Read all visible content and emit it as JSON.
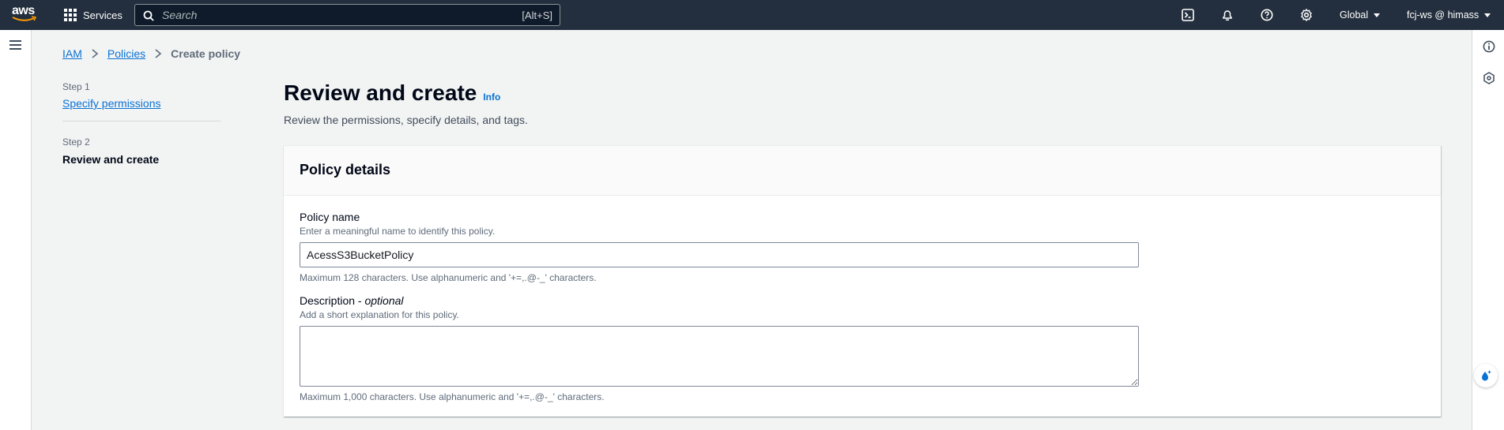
{
  "topnav": {
    "logo_text": "aws",
    "services_label": "Services",
    "search_placeholder": "Search",
    "search_shortcut": "[Alt+S]",
    "region": "Global",
    "account": "fcj-ws @ himass"
  },
  "breadcrumb": {
    "items": [
      "IAM",
      "Policies"
    ],
    "current": "Create policy"
  },
  "steps": [
    {
      "label": "Step 1",
      "title": "Specify permissions"
    },
    {
      "label": "Step 2",
      "title": "Review and create"
    }
  ],
  "header": {
    "title": "Review and create",
    "info": "Info",
    "description": "Review the permissions, specify details, and tags."
  },
  "policy_details": {
    "title": "Policy details",
    "name_label": "Policy name",
    "name_desc": "Enter a meaningful name to identify this policy.",
    "name_value": "AcessS3BucketPolicy",
    "name_constraint": "Maximum 128 characters. Use alphanumeric and '+=,.@-_' characters.",
    "description_label": "Description - ",
    "description_optional": "optional",
    "description_desc": "Add a short explanation for this policy.",
    "description_value": "",
    "description_constraint": "Maximum 1,000 characters. Use alphanumeric and '+=,.@-_' characters."
  },
  "colors": {
    "nav_bg": "#232f3e",
    "link": "#0972d3",
    "page_bg": "#f2f3f3"
  }
}
